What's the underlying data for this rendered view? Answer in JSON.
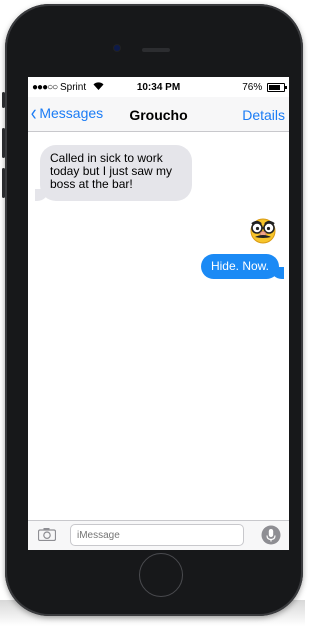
{
  "status_bar": {
    "signal": "●●●○○",
    "carrier": "Sprint",
    "wifi_icon": "wifi-icon",
    "time": "10:34 PM",
    "battery": "76%",
    "battery_level": 0.76
  },
  "nav": {
    "back_label": "Messages",
    "title": "Groucho",
    "details_label": "Details"
  },
  "messages": [
    {
      "direction": "incoming",
      "text": "Called in sick to work today but I just saw my boss at the bar!"
    },
    {
      "direction": "outgoing",
      "emoji": "groucho-glasses-emoji"
    },
    {
      "direction": "outgoing",
      "text": "Hide. Now."
    }
  ],
  "composer": {
    "placeholder": "iMessage",
    "camera_icon": "camera-icon",
    "mic_icon": "microphone-icon"
  },
  "colors": {
    "accent": "#1b7cf5",
    "outgoing_bubble": "#1b8af5",
    "incoming_bubble": "#e5e5ea",
    "phone_body": "#17181a"
  }
}
